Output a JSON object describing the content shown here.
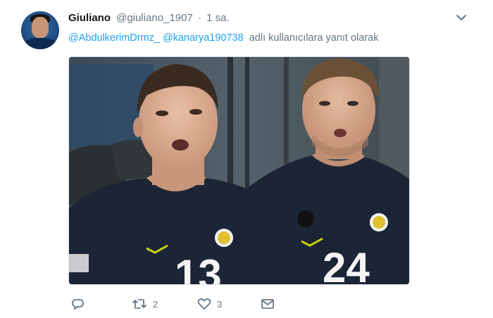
{
  "tweet": {
    "display_name": "Giuliano",
    "handle": "@giuliano_1907",
    "separator": "·",
    "time": "1 sa.",
    "reply_to": {
      "mentions": [
        "@AbdulkerimDrmz_",
        "@kanarya190738"
      ],
      "suffix": "adlı kullanıcılara yanıt olarak"
    },
    "media": {
      "left_jersey_number": "13",
      "right_jersey_number": "24"
    },
    "actions": {
      "reply_icon": "reply-icon",
      "retweet_icon": "retweet-icon",
      "retweet_count": "2",
      "like_icon": "heart-icon",
      "like_count": "3",
      "message_icon": "envelope-icon"
    }
  },
  "colors": {
    "link": "#1da1f2",
    "secondary_text": "#657786",
    "primary_text": "#14171a",
    "jersey": "#1c2536"
  }
}
